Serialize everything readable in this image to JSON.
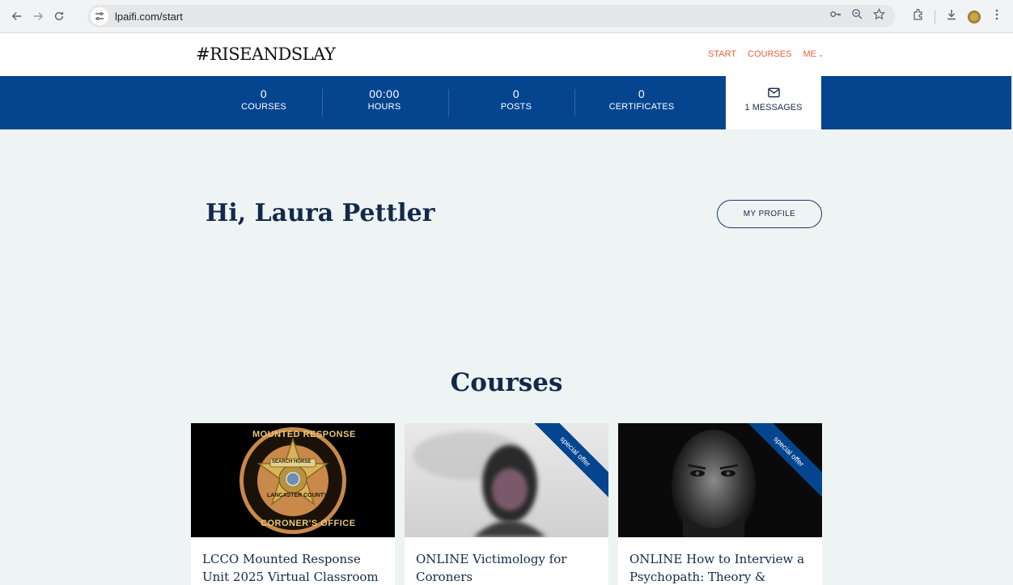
{
  "browser": {
    "url": "lpaifi.com/start"
  },
  "site": {
    "logo": "#RISEANDSLAY",
    "nav": [
      {
        "label": "START"
      },
      {
        "label": "COURSES"
      },
      {
        "label": "ME"
      }
    ],
    "accent_color": "#e8603c",
    "brand_color": "#05458f"
  },
  "stats": [
    {
      "value": "0",
      "label": "COURSES"
    },
    {
      "value": "00:00",
      "label": "HOURS"
    },
    {
      "value": "0",
      "label": "POSTS"
    },
    {
      "value": "0",
      "label": "CERTIFICATES"
    }
  ],
  "messages": {
    "label": "1 MESSAGES",
    "icon": "envelope-icon"
  },
  "greeting": "Hi, Laura Pettler",
  "profile_button": "MY PROFILE",
  "courses_title": "Courses",
  "courses": [
    {
      "title_line1": "LCCO Mounted Response",
      "title_line2": "Unit 2025 Virtual Classroom",
      "ribbon": ""
    },
    {
      "title_line1": "ONLINE Victimology for",
      "title_line2": "Coroners",
      "ribbon": "special offer"
    },
    {
      "title_line1": "ONLINE How to Interview a",
      "title_line2": "Psychopath: Theory &",
      "ribbon": "special offer"
    }
  ],
  "badge_text": {
    "top": "MOUNTED RESPONSE",
    "left": "SEARCH HORSE",
    "center": "LANCASTER COUNTY",
    "bottom": "CORONER'S OFFICE"
  }
}
